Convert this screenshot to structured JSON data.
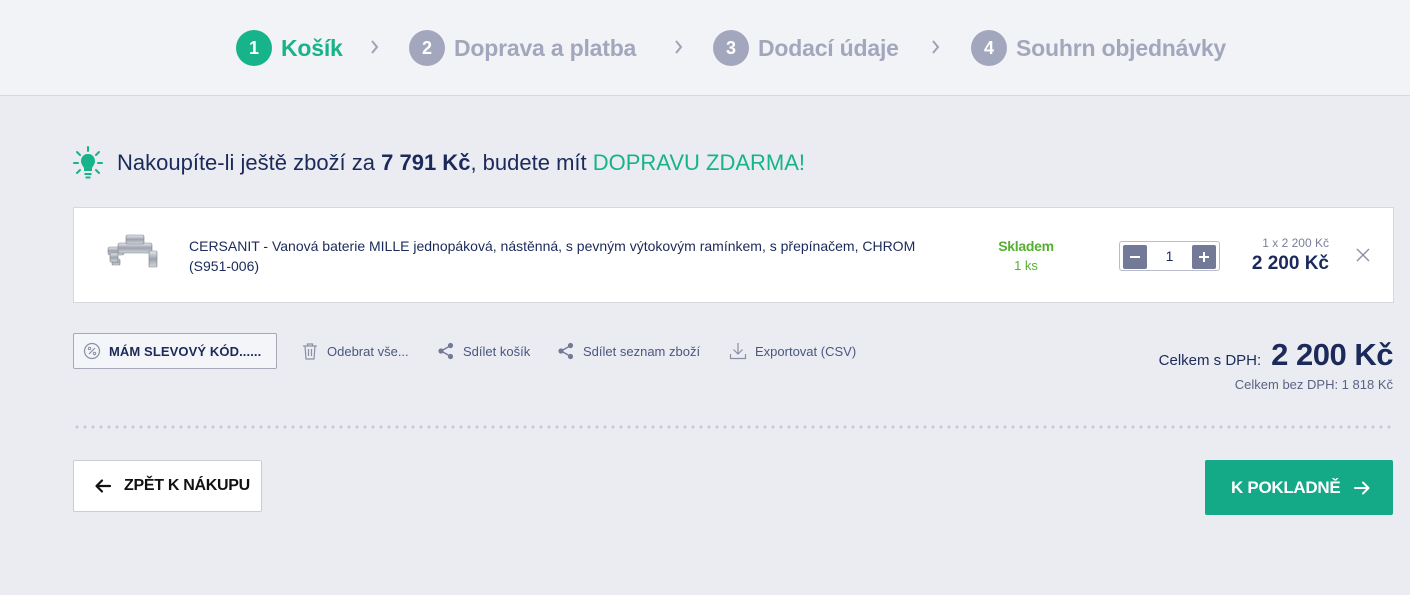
{
  "steps": [
    {
      "number": "1",
      "label": "Košík"
    },
    {
      "number": "2",
      "label": "Doprava a platba"
    },
    {
      "number": "3",
      "label": "Dodací údaje"
    },
    {
      "number": "4",
      "label": "Souhrn objednávky"
    }
  ],
  "promo": {
    "prefix": "Nakoupíte-li ještě zboží za ",
    "amount": "7 791 Kč",
    "middle": ", budete mít ",
    "highlight": "DOPRAVU ZDARMA!"
  },
  "cart": {
    "items": [
      {
        "name": "CERSANIT - Vanová baterie MILLE jednopáková, nástěnná, s pevným výtokovým ramínkem, s přepínačem, CHROM (S951-006)",
        "stock_status": "Skladem",
        "stock_count": "1 ks",
        "quantity": "1",
        "unit_price": "1 x 2 200 Kč",
        "total_price": "2 200 Kč"
      }
    ]
  },
  "actions": {
    "coupon": "MÁM SLEVOVÝ KÓD......",
    "remove_all": "Odebrat vše...",
    "share_cart": "Sdílet košík",
    "share_list": "Sdílet seznam zboží",
    "export": "Exportovat (CSV)"
  },
  "totals": {
    "with_vat_label": "Celkem s DPH:",
    "with_vat": "2 200 Kč",
    "without_vat": "Celkem bez DPH: 1 818 Kč"
  },
  "nav": {
    "back": "ZPĚT K NÁKUPU",
    "checkout": "K POKLADNĚ"
  },
  "colors": {
    "accent": "#17b38a",
    "checkout_button": "#14a987",
    "inactive_step": "#a3a7bd",
    "in_stock": "#54b030",
    "text_dark": "#1b2a5a"
  }
}
